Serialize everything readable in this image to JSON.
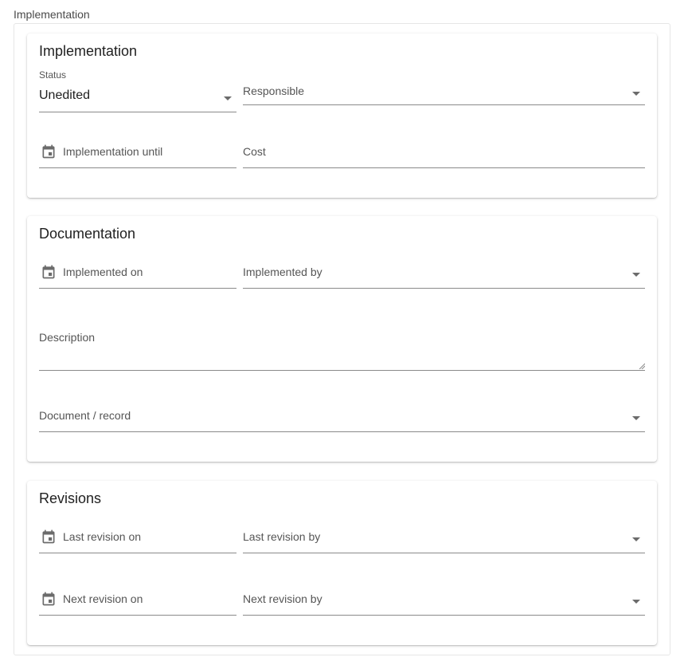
{
  "outer": {
    "legend": "Implementation"
  },
  "implementation": {
    "title": "Implementation",
    "status_label": "Status",
    "status_value": "Unedited",
    "responsible_label": "Responsible",
    "until_label": "Implementation until",
    "cost_label": "Cost"
  },
  "documentation": {
    "title": "Documentation",
    "implemented_on_label": "Implemented on",
    "implemented_by_label": "Implemented by",
    "description_label": "Description",
    "document_label": "Document / record"
  },
  "revisions": {
    "title": "Revisions",
    "last_on_label": "Last revision on",
    "last_by_label": "Last revision by",
    "next_on_label": "Next revision on",
    "next_by_label": "Next revision by"
  },
  "icons": {
    "calendar": "calendar-icon",
    "dropdown": "chevron-down-icon",
    "resize": "resize-handle-icon"
  },
  "colors": {
    "underline": "#8a8a8a",
    "icon": "#6b6b6b"
  }
}
